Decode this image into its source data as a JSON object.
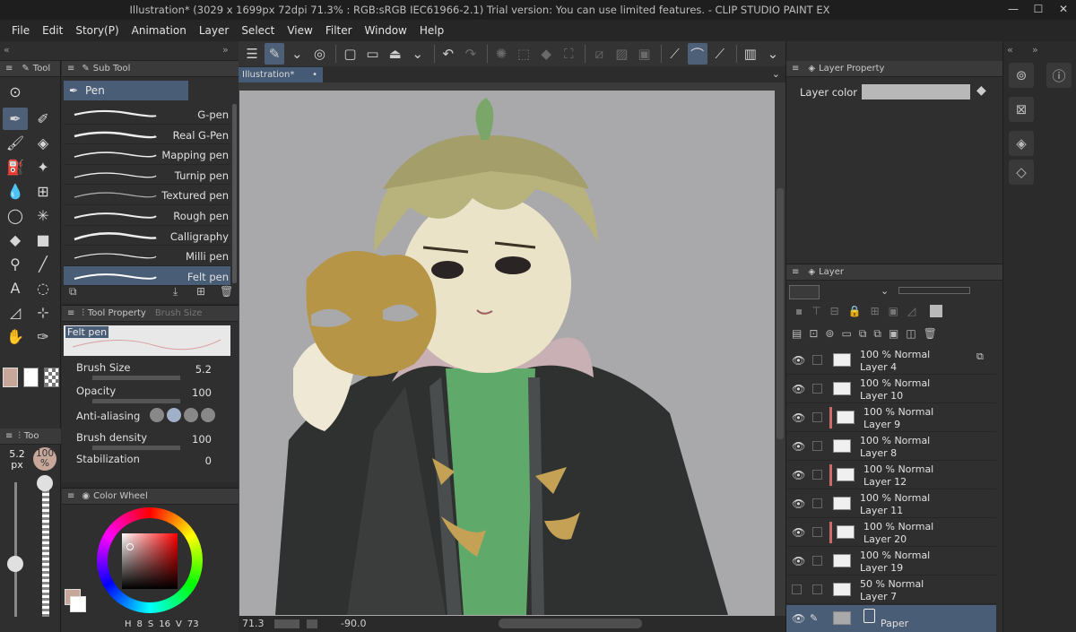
{
  "window": {
    "title": "Illustration* (3029 x 1699px 72dpi 71.3% : RGB:sRGB IEC61966-2.1)  Trial version: You can use limited features. - CLIP STUDIO PAINT EX",
    "minimize": "—",
    "maximize": "☐",
    "close": "✕"
  },
  "menu": [
    "File",
    "Edit",
    "Story(P)",
    "Animation",
    "Layer",
    "Select",
    "View",
    "Filter",
    "Window",
    "Help"
  ],
  "tool_panel": {
    "tab": "Tool",
    "sub_tab": "Too"
  },
  "sub_tool_panel": {
    "tab": "Sub Tool",
    "group": "Pen",
    "brushes": [
      "G-pen",
      "Real G-Pen",
      "Mapping pen",
      "Turnip pen",
      "Textured pen",
      "Rough pen",
      "Calligraphy",
      "Milli pen",
      "Felt pen"
    ],
    "selected": "Felt pen"
  },
  "tool_property": {
    "tab": "Tool Property",
    "tab2": "Brush Size",
    "preview_label": "Felt pen",
    "brush_size_label": "Brush Size",
    "brush_size_value": "5.2",
    "opacity_label": "Opacity",
    "opacity_value": "100",
    "antialiasing_label": "Anti-aliasing",
    "brush_density_label": "Brush density",
    "brush_density_value": "100",
    "stabilization_label": "Stabilization",
    "stabilization_value": "0"
  },
  "brush_size_strip": {
    "size": "5.2",
    "unit": "px",
    "opacity": "100",
    "opacity_unit": "%"
  },
  "color_wheel": {
    "tab": "Color Wheel",
    "readout": [
      "H",
      "8",
      "S",
      "16",
      "V",
      "73"
    ],
    "main_color": "#c7a79a",
    "sub_color": "#ffffff"
  },
  "document": {
    "tab": "Illustration*"
  },
  "status": {
    "zoom": "71.3",
    "angle": "-90.0"
  },
  "layer_property": {
    "tab": "Layer Property",
    "layer_color_label": "Layer color"
  },
  "layer_panel": {
    "tab": "Layer",
    "layers": [
      {
        "blend": "100 % Normal",
        "name": "Layer 4",
        "visible": true,
        "marked": false
      },
      {
        "blend": "100 % Normal",
        "name": "Layer 10",
        "visible": true,
        "marked": false
      },
      {
        "blend": "100 % Normal",
        "name": "Layer 9",
        "visible": true,
        "marked": true
      },
      {
        "blend": "100 % Normal",
        "name": "Layer 8",
        "visible": true,
        "marked": false
      },
      {
        "blend": "100 % Normal",
        "name": "Layer 12",
        "visible": true,
        "marked": true
      },
      {
        "blend": "100 % Normal",
        "name": "Layer 11",
        "visible": true,
        "marked": false
      },
      {
        "blend": "100 % Normal",
        "name": "Layer 20",
        "visible": true,
        "marked": true
      },
      {
        "blend": "100 % Normal",
        "name": "Layer 19",
        "visible": true,
        "marked": false
      },
      {
        "blend": "50 % Normal",
        "name": "Layer 7",
        "visible": false,
        "marked": false
      },
      {
        "blend": "",
        "name": "Paper",
        "visible": true,
        "marked": false
      }
    ]
  },
  "colors": {
    "accent": "#4a5d77",
    "panel": "#2f2f2f",
    "canvas_bg": "#a9a9ab",
    "layer_mark": "#d06a6a"
  }
}
